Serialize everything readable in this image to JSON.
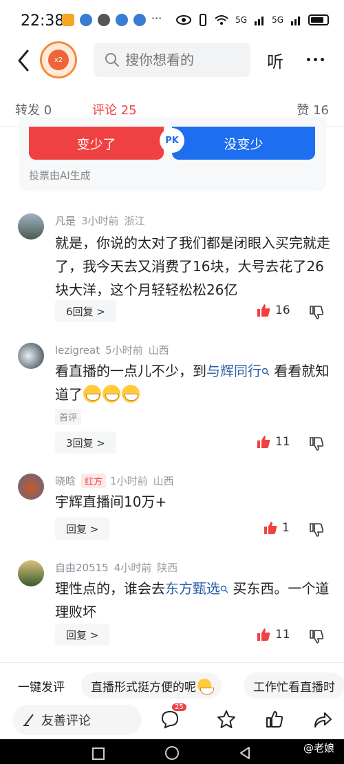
{
  "status": {
    "time": "22:38",
    "net1": "5G",
    "net2": "5G"
  },
  "header": {
    "search_placeholder": "搜你想看的",
    "listen": "听",
    "logo_text": "x2"
  },
  "tabs": {
    "forward": "转发 0",
    "comment": "评论 25",
    "like": "赞 16"
  },
  "vote": {
    "left": "变少了",
    "right": "没变少",
    "pk": "PK",
    "note": "投票由AI生成"
  },
  "comments": [
    {
      "name": "凡是",
      "time": "3小时前",
      "region": "浙江",
      "text1": "就是，你说的太对了我们都是闭眼入买完就走了，我今天去又消费了16块，大号去花了26块大洋，这个月轻轻松松26亿",
      "reply": "6回复 >",
      "likes": "16"
    },
    {
      "name": "lezigreat",
      "time": "5小时前",
      "region": "山西",
      "text_pre": "看直播的一点儿不少，到",
      "link": "与辉同行",
      "text_post": "看看就知道了",
      "tag": "首评",
      "reply": "3回复 >",
      "likes": "11"
    },
    {
      "name": "晓晗",
      "badge": "红方",
      "time": "1小时前",
      "region": "山西",
      "text1": "宇辉直播间10万+",
      "reply": "回复 >",
      "likes": "1"
    },
    {
      "name": "自由20515",
      "time": "4小时前",
      "region": "陕西",
      "text_pre": "理性点的，谁会去",
      "link": "东方甄选",
      "text_post": "买东西。一个道理败坏",
      "reply": "回复 >",
      "likes": "11"
    }
  ],
  "quick": {
    "item1": "一键发评",
    "item2": "直播形式挺方便的呢",
    "item3": "工作忙看直播时"
  },
  "bottom": {
    "write": "友善评论",
    "comment_count": "25"
  },
  "watermark": "@老娘",
  "colors": {
    "accent_red": "#f04142",
    "accent_blue": "#1e6ef0",
    "link": "#2b5fa8"
  }
}
